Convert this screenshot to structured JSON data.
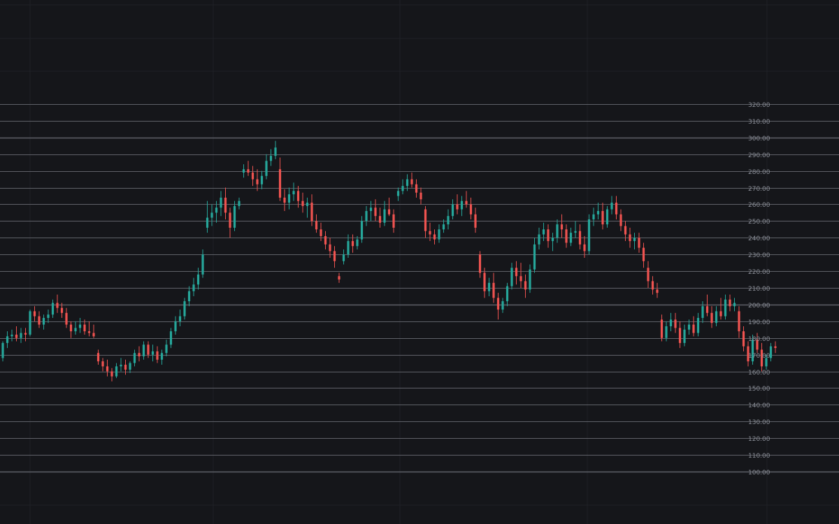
{
  "chart_data": {
    "type": "candlestick",
    "title": "",
    "xlabel": "",
    "ylabel": "",
    "ylim": [
      100,
      320
    ],
    "y_ticks": [
      "320.00",
      "310.00",
      "300.00",
      "290.00",
      "280.00",
      "270.00",
      "260.00",
      "250.00",
      "240.00",
      "230.00",
      "220.00",
      "210.00",
      "200.00",
      "190.00",
      "180.00",
      "170.00",
      "160.00",
      "150.00",
      "140.00",
      "130.00",
      "120.00",
      "110.00",
      "100.00"
    ],
    "grid": true,
    "colors": {
      "background": "#15161a",
      "up": "#26a69a",
      "down": "#ef5350",
      "price_line": "#5f6168",
      "minor_grid": "#1e2026",
      "tick_text": "#8b8f98"
    },
    "candles": [
      [
        168,
        178,
        166,
        177
      ],
      [
        177,
        184,
        174,
        181
      ],
      [
        181,
        185,
        178,
        182
      ],
      [
        182,
        187,
        178,
        180
      ],
      [
        180,
        186,
        177,
        183
      ],
      [
        183,
        186,
        178,
        182
      ],
      [
        182,
        197,
        181,
        196
      ],
      [
        196,
        199,
        190,
        193
      ],
      [
        193,
        196,
        186,
        188
      ],
      [
        188,
        194,
        185,
        192
      ],
      [
        192,
        197,
        189,
        194
      ],
      [
        194,
        203,
        192,
        201
      ],
      [
        201,
        206,
        195,
        198
      ],
      [
        198,
        201,
        192,
        195
      ],
      [
        195,
        198,
        186,
        188
      ],
      [
        188,
        190,
        180,
        184
      ],
      [
        184,
        190,
        182,
        186
      ],
      [
        186,
        192,
        183,
        188
      ],
      [
        188,
        191,
        182,
        184
      ],
      [
        184,
        190,
        181,
        183
      ],
      [
        183,
        188,
        180,
        181
      ],
      [
        171,
        173,
        164,
        166
      ],
      [
        166,
        168,
        160,
        163
      ],
      [
        163,
        167,
        157,
        160
      ],
      [
        160,
        162,
        154,
        157
      ],
      [
        157,
        165,
        156,
        163
      ],
      [
        163,
        168,
        160,
        164
      ],
      [
        164,
        167,
        158,
        161
      ],
      [
        161,
        166,
        159,
        165
      ],
      [
        165,
        173,
        163,
        171
      ],
      [
        171,
        175,
        166,
        169
      ],
      [
        169,
        178,
        167,
        176
      ],
      [
        176,
        178,
        168,
        170
      ],
      [
        170,
        176,
        166,
        172
      ],
      [
        172,
        175,
        165,
        167
      ],
      [
        167,
        173,
        164,
        171
      ],
      [
        171,
        179,
        169,
        176
      ],
      [
        176,
        186,
        174,
        184
      ],
      [
        184,
        193,
        182,
        190
      ],
      [
        190,
        197,
        187,
        193
      ],
      [
        193,
        204,
        191,
        202
      ],
      [
        202,
        211,
        199,
        208
      ],
      [
        208,
        216,
        205,
        212
      ],
      [
        212,
        222,
        209,
        218
      ],
      [
        218,
        233,
        216,
        230
      ],
      [
        246,
        262,
        243,
        252
      ],
      [
        252,
        260,
        247,
        255
      ],
      [
        255,
        262,
        249,
        258
      ],
      [
        258,
        268,
        253,
        264
      ],
      [
        264,
        270,
        251,
        255
      ],
      [
        255,
        258,
        240,
        246
      ],
      [
        246,
        262,
        244,
        259
      ],
      [
        259,
        264,
        257,
        262
      ],
      [
        279,
        284,
        276,
        281
      ],
      [
        281,
        286,
        277,
        279
      ],
      [
        279,
        283,
        271,
        275
      ],
      [
        275,
        281,
        268,
        272
      ],
      [
        272,
        280,
        269,
        277
      ],
      [
        277,
        290,
        275,
        286
      ],
      [
        286,
        293,
        283,
        289
      ],
      [
        289,
        298,
        287,
        294
      ],
      [
        281,
        288,
        262,
        264
      ],
      [
        264,
        269,
        256,
        261
      ],
      [
        261,
        270,
        257,
        266
      ],
      [
        266,
        273,
        262,
        268
      ],
      [
        268,
        271,
        258,
        262
      ],
      [
        262,
        267,
        255,
        259
      ],
      [
        259,
        264,
        252,
        261
      ],
      [
        261,
        266,
        247,
        250
      ],
      [
        250,
        254,
        243,
        245
      ],
      [
        245,
        249,
        238,
        241
      ],
      [
        241,
        244,
        233,
        236
      ],
      [
        236,
        240,
        228,
        232
      ],
      [
        232,
        235,
        222,
        226
      ],
      [
        217,
        219,
        213,
        215
      ],
      [
        226,
        233,
        224,
        230
      ],
      [
        230,
        242,
        228,
        238
      ],
      [
        238,
        242,
        231,
        235
      ],
      [
        235,
        241,
        233,
        239
      ],
      [
        239,
        253,
        237,
        250
      ],
      [
        250,
        259,
        247,
        256
      ],
      [
        256,
        262,
        250,
        258
      ],
      [
        258,
        263,
        250,
        253
      ],
      [
        253,
        258,
        246,
        249
      ],
      [
        249,
        262,
        247,
        257
      ],
      [
        257,
        264,
        253,
        254
      ],
      [
        254,
        257,
        243,
        246
      ],
      [
        265,
        270,
        262,
        268
      ],
      [
        268,
        275,
        266,
        271
      ],
      [
        271,
        278,
        268,
        275
      ],
      [
        275,
        279,
        270,
        272
      ],
      [
        272,
        275,
        264,
        267
      ],
      [
        267,
        270,
        260,
        263
      ],
      [
        257,
        259,
        240,
        244
      ],
      [
        244,
        249,
        238,
        242
      ],
      [
        242,
        245,
        236,
        239
      ],
      [
        239,
        248,
        237,
        245
      ],
      [
        245,
        251,
        243,
        248
      ],
      [
        248,
        257,
        245,
        253
      ],
      [
        253,
        263,
        251,
        260
      ],
      [
        260,
        266,
        254,
        257
      ],
      [
        257,
        265,
        253,
        262
      ],
      [
        262,
        268,
        258,
        260
      ],
      [
        260,
        264,
        251,
        254
      ],
      [
        254,
        258,
        243,
        246
      ],
      [
        230,
        232,
        216,
        219
      ],
      [
        219,
        222,
        204,
        208
      ],
      [
        208,
        216,
        205,
        213
      ],
      [
        213,
        219,
        201,
        204
      ],
      [
        204,
        207,
        191,
        197
      ],
      [
        197,
        204,
        195,
        202
      ],
      [
        202,
        213,
        199,
        211
      ],
      [
        211,
        225,
        209,
        222
      ],
      [
        222,
        226,
        212,
        217
      ],
      [
        217,
        225,
        210,
        214
      ],
      [
        214,
        218,
        204,
        209
      ],
      [
        209,
        224,
        207,
        221
      ],
      [
        221,
        240,
        219,
        236
      ],
      [
        236,
        246,
        233,
        242
      ],
      [
        242,
        249,
        238,
        245
      ],
      [
        245,
        248,
        234,
        238
      ],
      [
        238,
        243,
        232,
        240
      ],
      [
        240,
        251,
        237,
        248
      ],
      [
        248,
        254,
        240,
        245
      ],
      [
        245,
        248,
        234,
        237
      ],
      [
        237,
        246,
        235,
        243
      ],
      [
        243,
        250,
        240,
        244
      ],
      [
        244,
        248,
        233,
        236
      ],
      [
        236,
        241,
        228,
        232
      ],
      [
        232,
        254,
        230,
        251
      ],
      [
        251,
        258,
        247,
        254
      ],
      [
        254,
        261,
        251,
        256
      ],
      [
        256,
        261,
        245,
        248
      ],
      [
        248,
        259,
        246,
        257
      ],
      [
        257,
        265,
        254,
        261
      ],
      [
        261,
        265,
        251,
        254
      ],
      [
        254,
        257,
        244,
        247
      ],
      [
        247,
        250,
        238,
        242
      ],
      [
        242,
        246,
        234,
        238
      ],
      [
        238,
        243,
        233,
        240
      ],
      [
        240,
        243,
        231,
        234
      ],
      [
        234,
        237,
        222,
        226
      ],
      [
        222,
        226,
        210,
        214
      ],
      [
        214,
        217,
        206,
        209
      ],
      [
        209,
        213,
        204,
        207
      ],
      [
        191,
        194,
        178,
        180
      ],
      [
        180,
        190,
        178,
        187
      ],
      [
        187,
        195,
        184,
        191
      ],
      [
        191,
        195,
        183,
        186
      ],
      [
        186,
        190,
        174,
        177
      ],
      [
        177,
        188,
        175,
        185
      ],
      [
        185,
        191,
        182,
        188
      ],
      [
        188,
        193,
        181,
        183
      ],
      [
        183,
        195,
        181,
        192
      ],
      [
        192,
        202,
        189,
        199
      ],
      [
        199,
        206,
        193,
        195
      ],
      [
        195,
        199,
        186,
        189
      ],
      [
        189,
        199,
        187,
        196
      ],
      [
        196,
        204,
        191,
        193
      ],
      [
        193,
        206,
        191,
        203
      ],
      [
        203,
        206,
        196,
        199
      ],
      [
        199,
        204,
        196,
        201
      ],
      [
        196,
        199,
        180,
        184
      ],
      [
        184,
        187,
        172,
        175
      ],
      [
        175,
        178,
        163,
        166
      ],
      [
        166,
        182,
        164,
        179
      ],
      [
        179,
        183,
        171,
        173
      ],
      [
        173,
        177,
        160,
        163
      ],
      [
        163,
        170,
        161,
        168
      ],
      [
        168,
        177,
        166,
        175
      ],
      [
        175,
        178,
        171,
        174
      ]
    ]
  }
}
